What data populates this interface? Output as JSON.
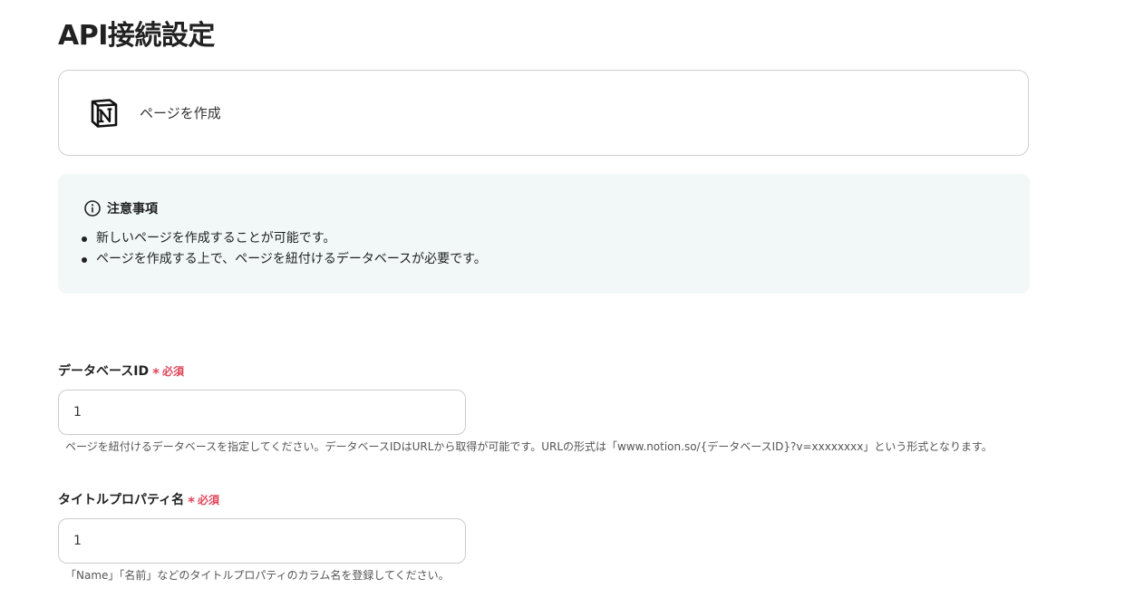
{
  "page": {
    "title": "API接続設定"
  },
  "action": {
    "app_icon": "notion-logo-icon",
    "label": "ページを作成"
  },
  "notice": {
    "icon": "info-circle-icon",
    "title": "注意事項",
    "items": [
      "新しいページを作成することが可能です。",
      "ページを作成する上で、ページを紐付けるデータベースが必要です。"
    ]
  },
  "fields": [
    {
      "label": "データベースID",
      "required_mark": "*",
      "required_text": "必須",
      "value": "1",
      "help": "ページを紐付けるデータベースを指定してください。データベースIDはURLから取得が可能です。URLの形式は「www.notion.so/{データベースID}?v=xxxxxxxx」という形式となります。"
    },
    {
      "label": "タイトルプロパティ名",
      "required_mark": "*",
      "required_text": "必須",
      "value": "1",
      "help": "「Name」「名前」などのタイトルプロパティのカラム名を登録してください。"
    }
  ],
  "colors": {
    "required": "#e0465a",
    "notice_bg": "#f1f8f7",
    "border": "#cccccc",
    "text": "#222222"
  }
}
